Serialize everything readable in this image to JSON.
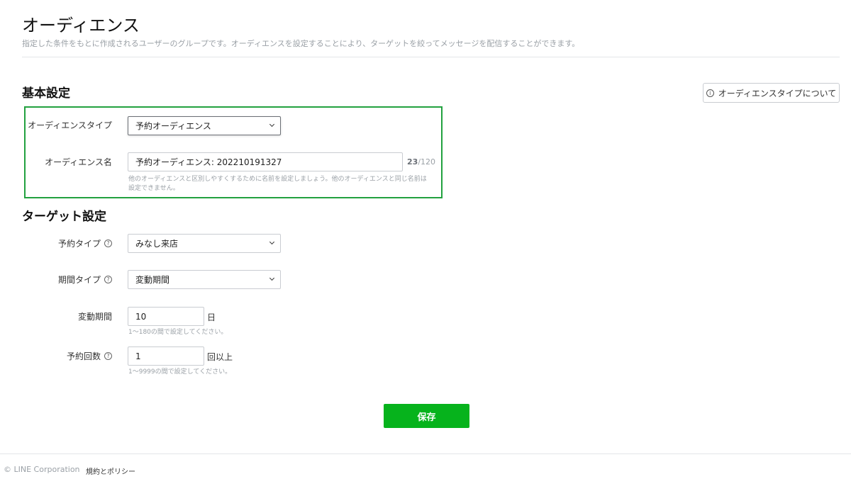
{
  "header": {
    "title": "オーディエンス",
    "description": "指定した条件をもとに作成されるユーザーのグループです。オーディエンスを設定することにより、ターゲットを絞ってメッセージを配信することができます。"
  },
  "basic": {
    "section_title": "基本設定",
    "info_button_label": "オーディエンスタイプについて",
    "audience_type": {
      "label": "オーディエンスタイプ",
      "value": "予約オーディエンス"
    },
    "audience_name": {
      "label": "オーディエンス名",
      "value": "予約オーディエンス: 202210191327",
      "count_current": "23",
      "count_max": "/120",
      "hint_line1": "他のオーディエンスと区別しやすくするために名前を設定しましょう。他のオーディエンスと同じ名前は",
      "hint_line2": "設定できません。"
    }
  },
  "target": {
    "section_title": "ターゲット設定",
    "reservation_type": {
      "label": "予約タイプ",
      "value": "みなし来店"
    },
    "period_type": {
      "label": "期間タイプ",
      "value": "変動期間"
    },
    "variable_period": {
      "label": "変動期間",
      "value": "10",
      "unit": "日",
      "hint": "1〜180の間で設定してください。"
    },
    "reservation_count": {
      "label": "予約回数",
      "value": "1",
      "unit": "回以上",
      "hint": "1〜9999の間で設定してください。"
    }
  },
  "actions": {
    "save_label": "保存"
  },
  "footer": {
    "copyright": "© LINE Corporation",
    "policy_link": "規約とポリシー"
  },
  "colors": {
    "accent": "#06b31c",
    "highlight_border": "#22a13f"
  },
  "icons": {
    "info": "info-circle-icon",
    "help": "question-circle-icon",
    "dropdown": "chevron-down-icon"
  }
}
